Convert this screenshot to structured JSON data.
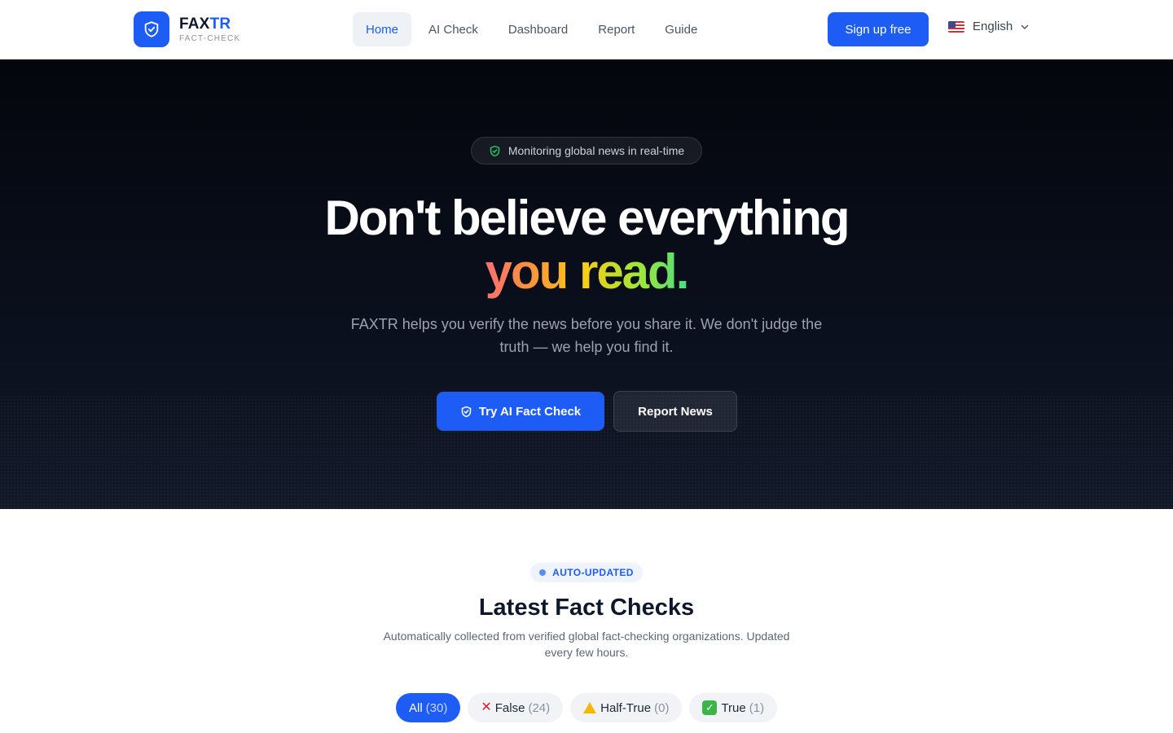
{
  "brand": {
    "name_part1": "FAX",
    "name_part2": "TR",
    "subtitle": "FACT-CHECK"
  },
  "nav": {
    "items": [
      {
        "label": "Home",
        "active": true
      },
      {
        "label": "AI Check",
        "active": false
      },
      {
        "label": "Dashboard",
        "active": false
      },
      {
        "label": "Report",
        "active": false
      },
      {
        "label": "Guide",
        "active": false
      }
    ],
    "signup_label": "Sign up free",
    "language": {
      "label": "English",
      "flag_icon": "us-flag-icon"
    }
  },
  "hero": {
    "pill_text": "Monitoring global news in real-time",
    "headline_line1": "Don't believe everything",
    "headline_line2": "you read.",
    "subtitle": "FAXTR helps you verify the news before you share it. We don't judge the truth — we help you find it.",
    "primary_cta": "Try AI Fact Check",
    "secondary_cta": "Report News"
  },
  "latest": {
    "badge": "AUTO-UPDATED",
    "title": "Latest Fact Checks",
    "description": "Automatically collected from verified global fact-checking organizations. Updated every few hours.",
    "filters": [
      {
        "label": "All",
        "count": "(30)",
        "active": true
      },
      {
        "label": "False",
        "count": "(24)",
        "icon": "cross-mark-icon"
      },
      {
        "label": "Half-True",
        "count": "(0)",
        "icon": "warning-icon"
      },
      {
        "label": "True",
        "count": "(1)",
        "icon": "check-mark-icon"
      }
    ]
  },
  "colors": {
    "accent": "#1d5cf5",
    "hero_background": "#070b15",
    "gradient_text": [
      "#f87171",
      "#fb923c",
      "#facc15",
      "#a3e635",
      "#4ade80"
    ]
  }
}
